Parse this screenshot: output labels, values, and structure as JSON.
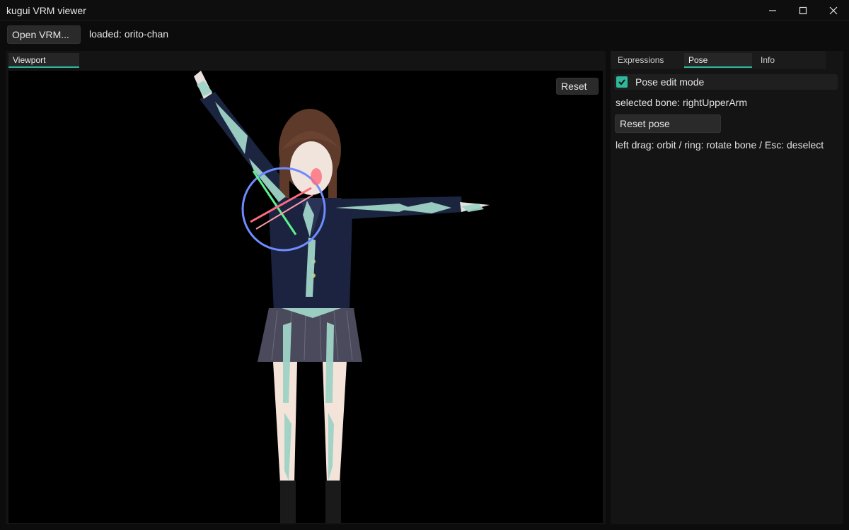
{
  "window": {
    "title": "kugui VRM viewer",
    "controls": [
      "minimize-icon",
      "maximize-icon",
      "close-icon"
    ]
  },
  "toolbar": {
    "open_label": "Open VRM...",
    "status": "loaded: orito-chan"
  },
  "viewport_panel": {
    "tab_label": "Viewport",
    "reset_label": "Reset"
  },
  "side_panel": {
    "tabs": [
      {
        "label": "Expressions",
        "active": false
      },
      {
        "label": "Pose",
        "active": true
      },
      {
        "label": "Info",
        "active": false
      }
    ],
    "pose_edit_label": "Pose edit mode",
    "pose_edit_checked": true,
    "selected_bone": "selected bone: rightUpperArm",
    "reset_pose_label": "Reset pose",
    "hint": "left drag: orbit / ring: rotate bone / Esc: deselect"
  },
  "colors": {
    "accent": "#2fb89b",
    "background": "#0c0c0c",
    "panel": "#141414",
    "button": "#2a2a2a",
    "bone": "#9fd3c7",
    "rotation_ring": "#6f8cff"
  }
}
